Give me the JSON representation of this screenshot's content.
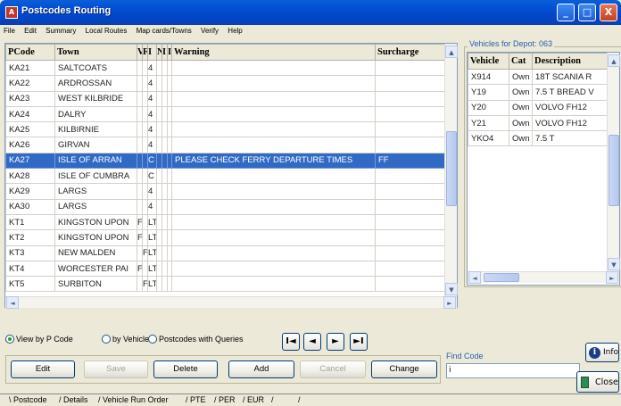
{
  "window": {
    "app_icon_text": "A",
    "title": "Postcodes Routing",
    "controls": [
      "_",
      "□",
      "X"
    ]
  },
  "menu": [
    "File",
    "Edit",
    "Summary",
    "Local Routes",
    "Map cards/Towns",
    "Verify",
    "Help"
  ],
  "postcode_grid": {
    "columns": [
      "PCode",
      "Town",
      "V",
      "F",
      "I",
      "N",
      "I",
      "I",
      "Warning",
      "Surcharge"
    ],
    "rows": [
      [
        "KA21",
        "SALTCOATS",
        "",
        "",
        "4",
        "",
        "",
        "",
        "",
        ""
      ],
      [
        "KA22",
        "ARDROSSAN",
        "",
        "",
        "4",
        "",
        "",
        "",
        "",
        ""
      ],
      [
        "KA23",
        "WEST KILBRIDE",
        "",
        "",
        "4",
        "",
        "",
        "",
        "",
        ""
      ],
      [
        "KA24",
        "DALRY",
        "",
        "",
        "4",
        "",
        "",
        "",
        "",
        ""
      ],
      [
        "KA25",
        "KILBIRNIE",
        "",
        "",
        "4",
        "",
        "",
        "",
        "",
        ""
      ],
      [
        "KA26",
        "GIRVAN",
        "",
        "",
        "4",
        "",
        "",
        "",
        "",
        ""
      ],
      [
        "KA27",
        "ISLE OF ARRAN",
        "",
        "",
        "C",
        "",
        "",
        "",
        "PLEASE CHECK FERRY DEPARTURE TIMES",
        "FF"
      ],
      [
        "KA28",
        "ISLE OF CUMBRA",
        "",
        "",
        "C",
        "",
        "",
        "",
        "",
        ""
      ],
      [
        "KA29",
        "LARGS",
        "",
        "",
        "4",
        "",
        "",
        "",
        "",
        ""
      ],
      [
        "KA30",
        "LARGS",
        "",
        "",
        "4",
        "",
        "",
        "",
        "",
        ""
      ],
      [
        "KT1",
        "KINGSTON UPON",
        "F",
        "",
        "LT",
        "",
        "",
        "",
        "",
        ""
      ],
      [
        "KT2",
        "KINGSTON UPON",
        "F",
        "",
        "LT",
        "",
        "",
        "",
        "",
        ""
      ],
      [
        "KT3",
        "NEW MALDEN",
        "",
        "F",
        "LT",
        "",
        "",
        "",
        "",
        ""
      ],
      [
        "KT4",
        "WORCESTER PAI",
        "F",
        "",
        "LT",
        "",
        "",
        "",
        "",
        ""
      ],
      [
        "KT5",
        "SURBITON",
        "",
        "F",
        "LT",
        "",
        "",
        "",
        "",
        ""
      ]
    ],
    "selected_index": 6
  },
  "vehicles": {
    "legend": "Vehicles for Depot: 063",
    "columns": [
      "Vehicle",
      "Cat",
      "Description"
    ],
    "rows": [
      [
        "X914",
        "Own",
        "18T  SCANIA R"
      ],
      [
        "Y19",
        "Own",
        "7.5 T BREAD V"
      ],
      [
        "Y20",
        "Own",
        "VOLVO FH12"
      ],
      [
        "Y21",
        "Own",
        "VOLVO FH12"
      ],
      [
        "YKO4",
        "Own",
        "7.5 T"
      ]
    ]
  },
  "view_options": {
    "by_pcode": "View by P Code",
    "by_vehicle": "by Vehicle",
    "with_queries": "Postcodes with Queries",
    "selected": "by_pcode"
  },
  "record_nav": {
    "first": "I◄",
    "prev": "◄",
    "next": "►",
    "last": "►I"
  },
  "actions": {
    "edit": "Edit",
    "save": "Save",
    "delete": "Delete",
    "add": "Add",
    "cancel": "Cancel",
    "change": "Change"
  },
  "find": {
    "legend": "Find Code",
    "value": "i"
  },
  "info_label": "Info",
  "close_label": "Close",
  "tabs": [
    "Postcode",
    "Details",
    "Vehicle Run Order",
    "PTE",
    "PER",
    "EUR",
    "",
    ""
  ]
}
